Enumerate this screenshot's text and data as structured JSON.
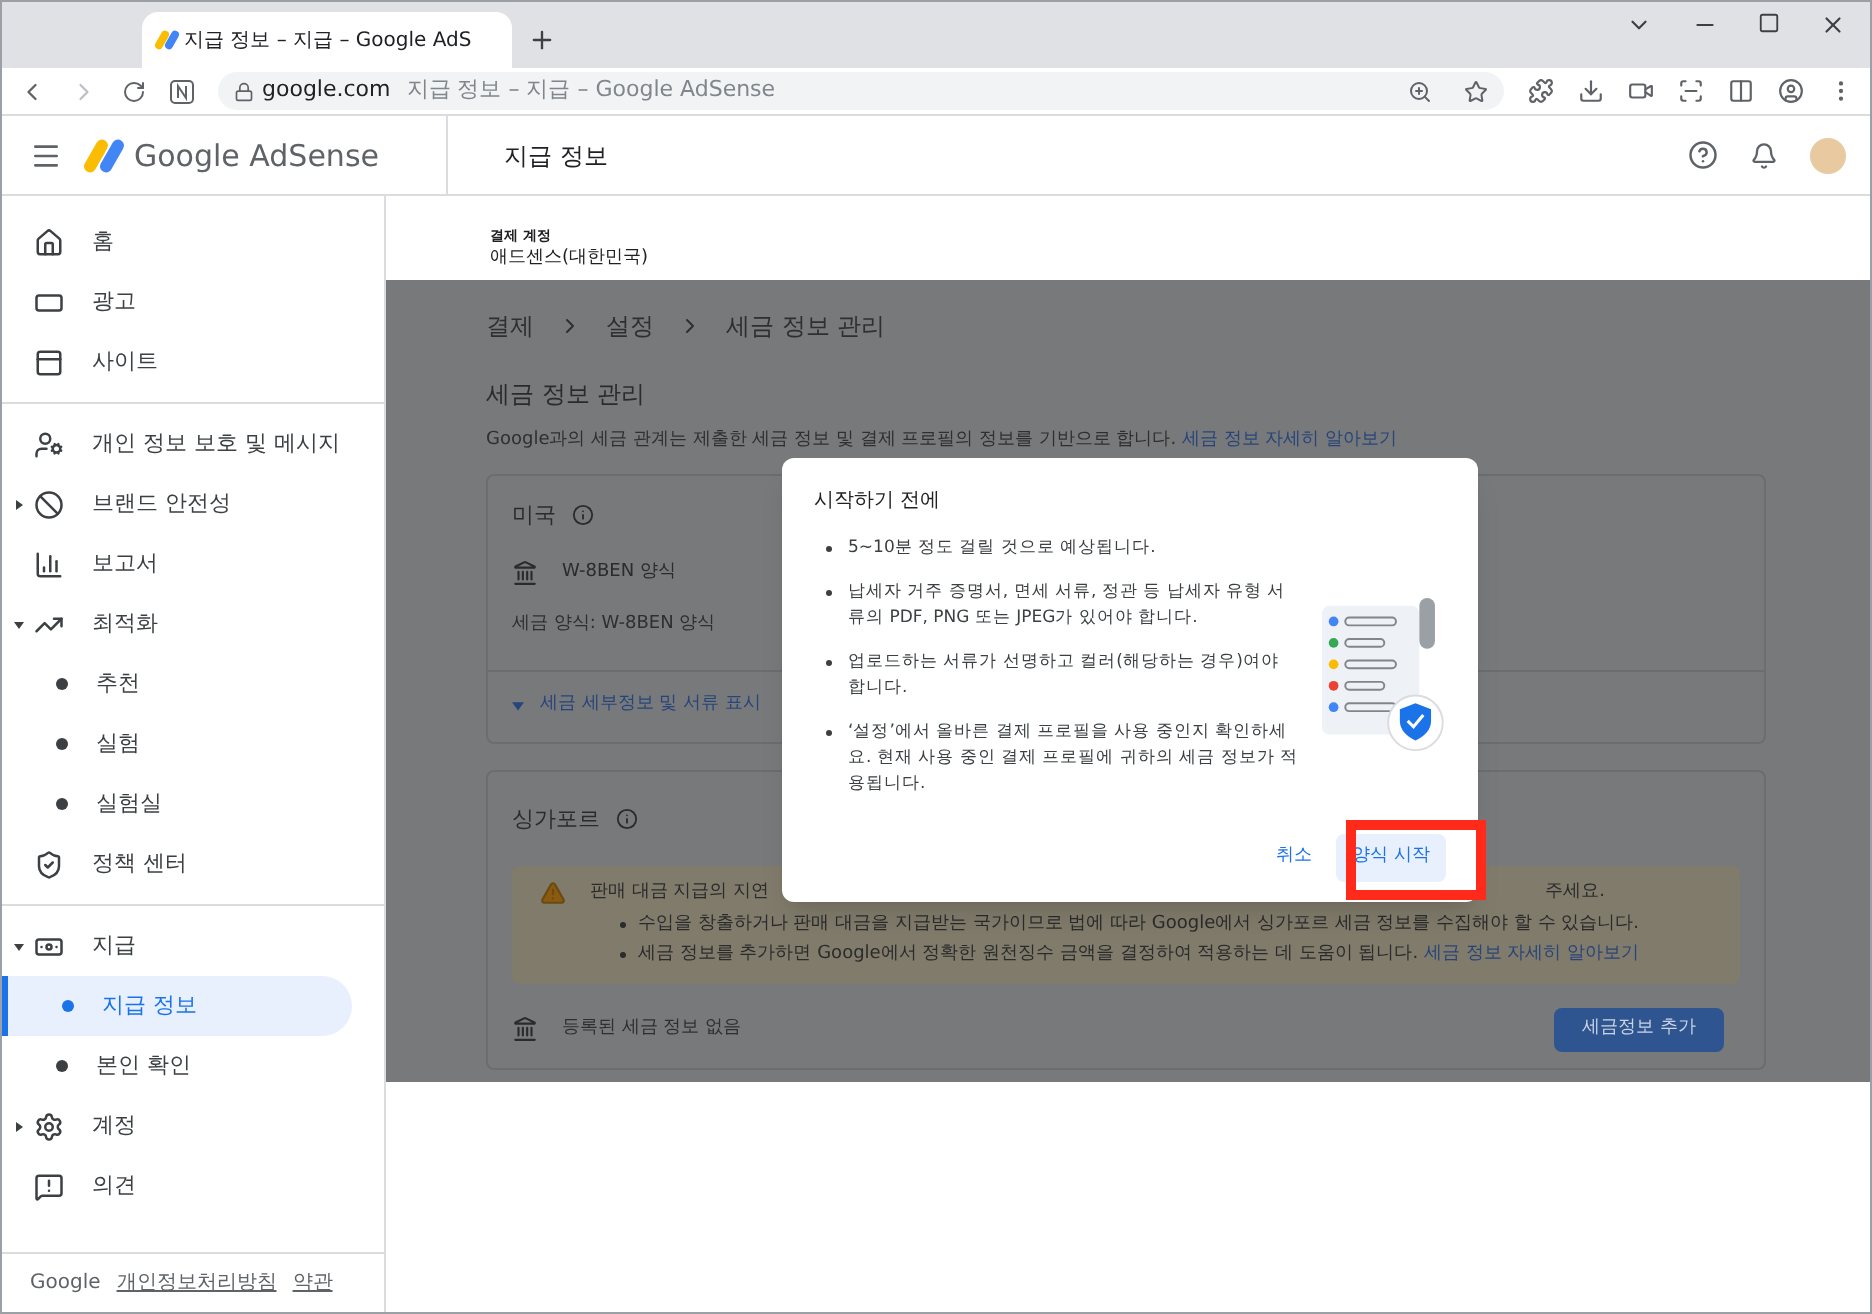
{
  "browser": {
    "tab_title": "지급 정보 – 지급 – Google AdS",
    "url_domain": "google.com",
    "url_title": "지급 정보 – 지급 – Google AdSense"
  },
  "header": {
    "app_name": "Google AdSense",
    "page_title": "지급 정보"
  },
  "sidebar": {
    "sections": [
      [
        {
          "label": "홈",
          "selected": false
        },
        {
          "label": "광고",
          "selected": false
        },
        {
          "label": "사이트",
          "selected": false
        }
      ],
      [
        {
          "label": "개인 정보 보호 및 메시지",
          "selected": false
        },
        {
          "label": "브랜드 안전성",
          "selected": false,
          "expanded": false
        },
        {
          "label": "보고서",
          "selected": false
        },
        {
          "label": "최적화",
          "selected": false,
          "expanded": true,
          "children": [
            {
              "label": "추천",
              "selected": false
            },
            {
              "label": "실험",
              "selected": false
            },
            {
              "label": "실험실",
              "selected": false
            }
          ]
        },
        {
          "label": "정책 센터",
          "selected": false
        }
      ],
      [
        {
          "label": "지급",
          "selected": false,
          "expanded": true,
          "children": [
            {
              "label": "지급 정보",
              "selected": true
            },
            {
              "label": "본인 확인",
              "selected": false
            }
          ]
        },
        {
          "label": "계정",
          "selected": false,
          "expanded": false
        },
        {
          "label": "의견",
          "selected": false
        }
      ]
    ],
    "footer": {
      "brand": "Google",
      "links": [
        "개인정보처리방침",
        "약관"
      ]
    }
  },
  "account": {
    "label": "결제 계정",
    "value": "애드센스(대한민국)"
  },
  "breadcrumb": [
    "결제",
    "설정",
    "세금 정보 관리"
  ],
  "heading": "세금 정보 관리",
  "description": {
    "text": "Google과의 세금 관계는 제출한 세금 정보 및 결제 프로필의 정보를 기반으로 합니다.",
    "link": "세금 정보 자세히 알아보기"
  },
  "us_card": {
    "title": "미국",
    "form": "W-8BEN 양식",
    "form_detail": "세금 양식: W-8BEN 양식",
    "toggle": "세금 세부정보 및 서류 표시"
  },
  "sg_card": {
    "title": "싱가포르",
    "warning": {
      "line_start": "판매 대금 지급의 지연",
      "line_end": "주세요.",
      "bullets": [
        {
          "text": "수입을 창출하거나 판매 대금을 지급받는 국가이므로 법에 따라 Google에서 싱가포르 세금 정보를 수집해야 할 수 있습니다."
        },
        {
          "text": "세금 정보를 추가하면 Google에서 정확한 원천징수 금액을 결정하여 적용하는 데 도움이 됩니다.",
          "link": "세금 정보 자세히 알아보기"
        }
      ]
    },
    "empty": "등록된 세금 정보 없음",
    "button": "세금정보 추가"
  },
  "modal": {
    "title": "시작하기 전에",
    "bullets": [
      "5~10분 정도 걸릴 것으로 예상됩니다.",
      "납세자 거주 증명서, 면세 서류, 정관 등 납세자 유형 서류의 PDF, PNG 또는 JPEG가 있어야 합니다.",
      "업로드하는 서류가 선명하고 컬러(해당하는 경우)여야 합니다.",
      "‘설정’에서 올바른 결제 프로필을 사용 중인지 확인하세요. 현재 사용 중인 결제 프로필에 귀하의 세금 정보가 적용됩니다."
    ],
    "cancel": "취소",
    "confirm": "양식 시작",
    "confirm_highlighted": true
  }
}
